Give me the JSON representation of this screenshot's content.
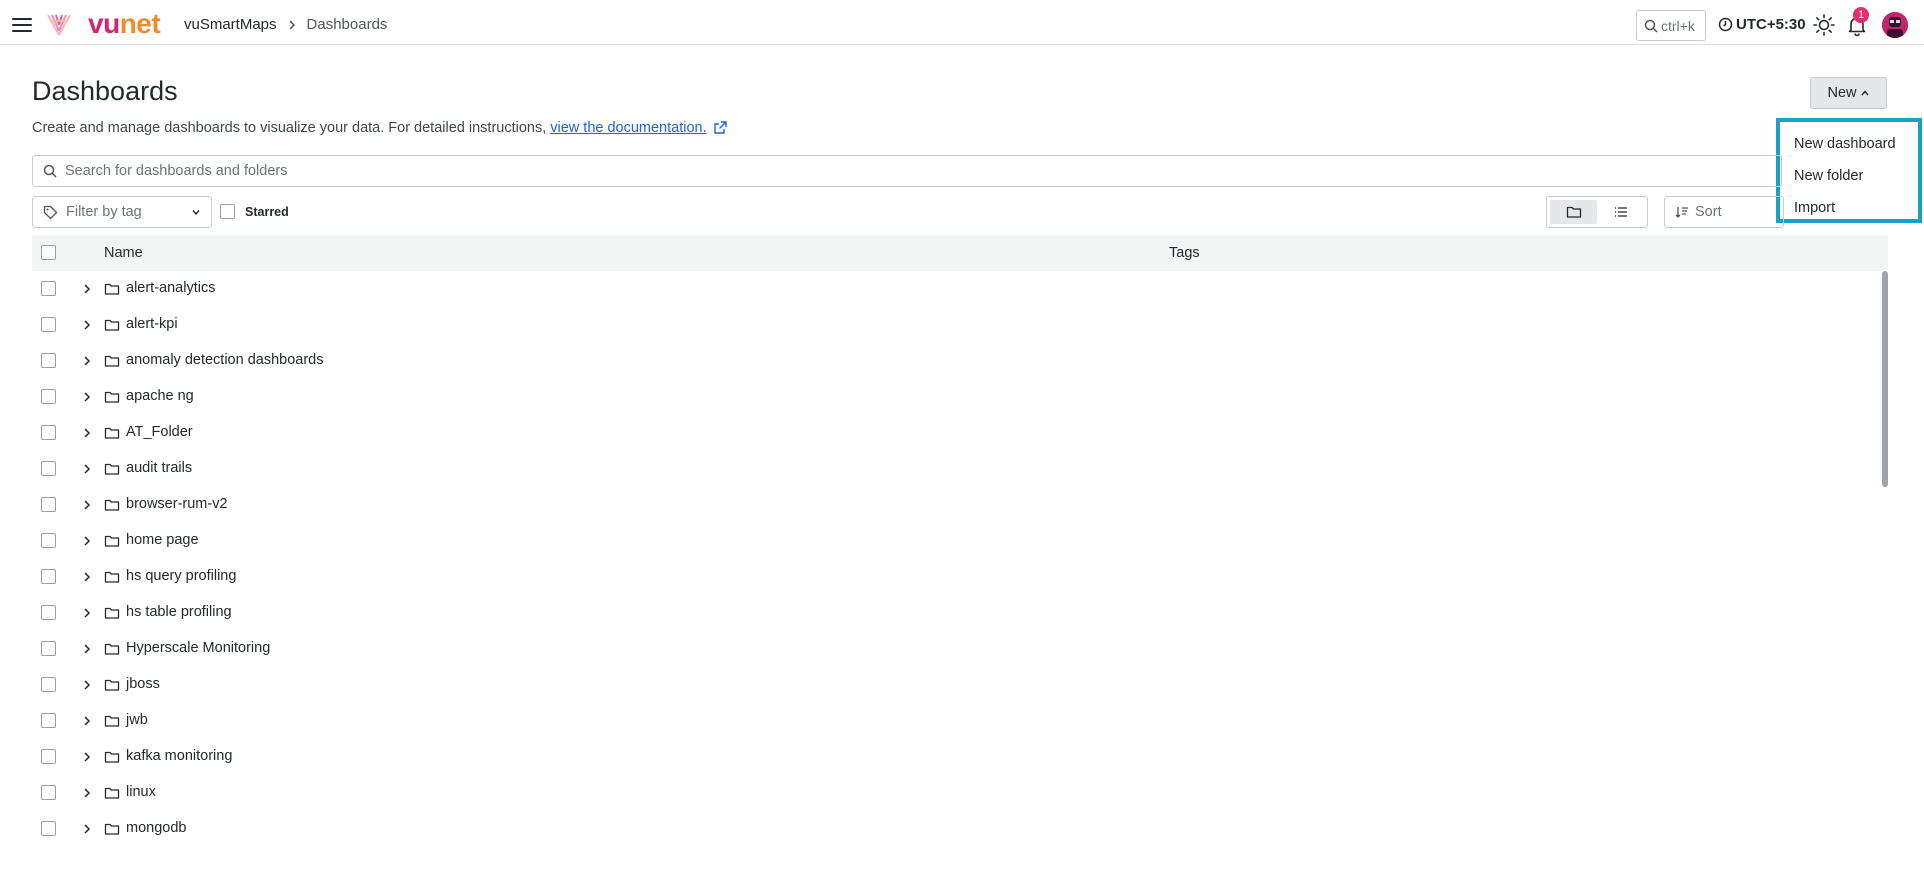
{
  "topbar": {
    "logo_vu": "vu",
    "logo_net": "net",
    "breadcrumb": [
      "vuSmartMaps",
      "Dashboards"
    ],
    "search_shortcut": "ctrl+k",
    "timezone": "UTC+5:30",
    "notification_count": "1"
  },
  "page": {
    "title": "Dashboards",
    "description": "Create and manage dashboards to visualize your data. For detailed instructions,",
    "doc_link": "view the documentation.",
    "new_button": "New"
  },
  "new_menu": {
    "items": [
      "New dashboard",
      "New folder",
      "Import"
    ]
  },
  "search": {
    "placeholder": "Search for dashboards and folders"
  },
  "filters": {
    "tag_placeholder": "Filter by tag",
    "starred_label": "Starred",
    "sort_placeholder": "Sort",
    "active_view": "folder"
  },
  "table": {
    "columns": {
      "name": "Name",
      "tags": "Tags"
    },
    "rows": [
      "alert-analytics",
      "alert-kpi",
      "anomaly detection dashboards",
      "apache ng",
      "AT_Folder",
      "audit trails",
      "browser-rum-v2",
      "home page",
      "hs query profiling",
      "hs table profiling",
      "Hyperscale Monitoring",
      "jboss",
      "jwb",
      "kafka monitoring",
      "linux",
      "mongodb"
    ]
  },
  "colors": {
    "accent_highlight": "#16a2c4",
    "logo_pink": "#d6246e",
    "logo_orange": "#f08c2a",
    "link": "#1f62e0",
    "badge": "#e02f6b"
  }
}
